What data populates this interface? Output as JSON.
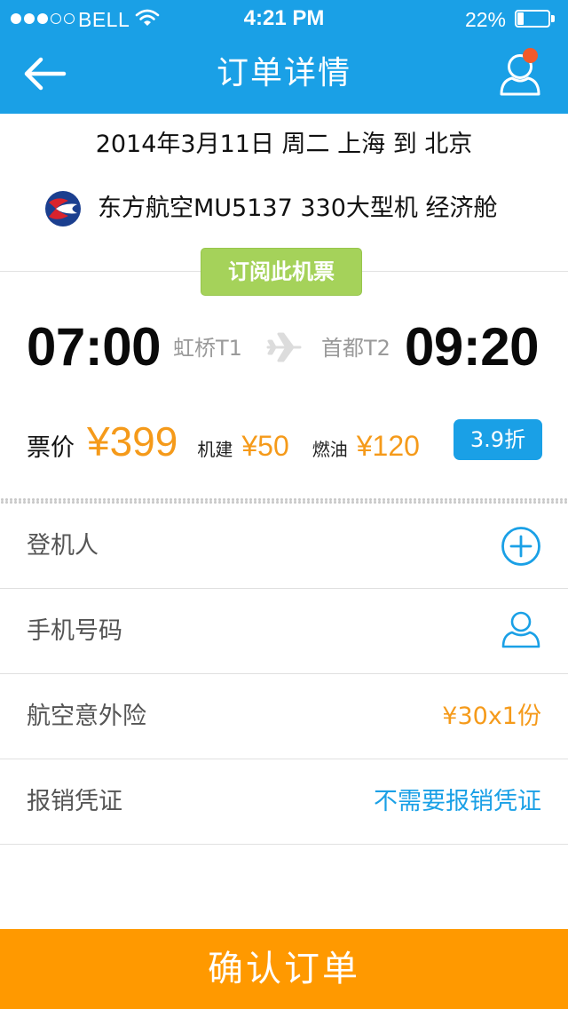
{
  "status_bar": {
    "carrier": "BELL",
    "time": "4:21 PM",
    "battery_percent": "22%",
    "battery_level": 0.22,
    "signal_bars_filled": 3,
    "signal_bars_total": 5
  },
  "nav": {
    "title": "订单详情",
    "back_icon": "arrow-left-icon",
    "profile_icon": "user-icon"
  },
  "flight": {
    "date_line": "2014年3月11日 周二 上海 到 北京",
    "airline_info": "东方航空MU5137  330大型机   经济舱",
    "subscribe_label": "订阅此机票",
    "departure_time": "07:00",
    "departure_airport": "虹桥T1",
    "arrival_time": "09:20",
    "arrival_airport": "首都T2"
  },
  "price": {
    "label": "票价",
    "ticket": "¥399",
    "airport_fee_label": "机建",
    "airport_fee": "¥50",
    "fuel_label": "燃油",
    "fuel_fee": "¥120",
    "discount": "3.9折"
  },
  "form": {
    "passenger_label": "登机人",
    "phone_label": "手机号码",
    "insurance_label": "航空意外险",
    "insurance_value": "¥30x1份",
    "receipt_label": "报销凭证",
    "receipt_value": "不需要报销凭证"
  },
  "confirm_label": "确认订单",
  "colors": {
    "header_blue": "#1aa0e6",
    "price_orange": "#f59a1a",
    "subscribe_green": "#a5d25a",
    "confirm_orange": "#ff9900",
    "notify_red": "#f15a2b"
  }
}
